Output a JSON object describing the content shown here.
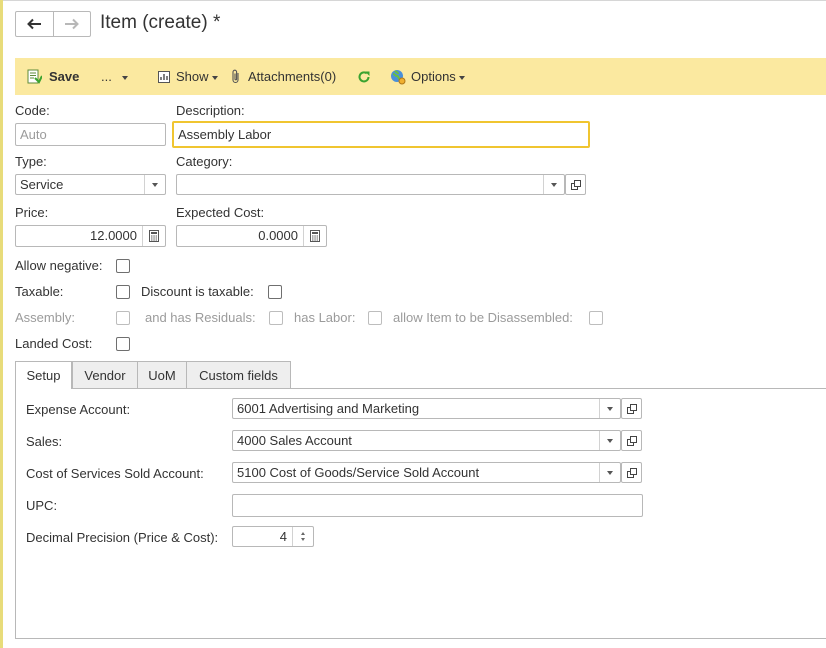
{
  "header": {
    "title": "Item (create) *"
  },
  "icons": {
    "back": "arrow-left-icon",
    "forward": "arrow-right-icon",
    "save": "save-document-icon",
    "show": "report-icon",
    "attachments": "paperclip-icon",
    "refresh": "refresh-icon",
    "options": "globe-gear-icon",
    "calendar": "calculator-icon",
    "open": "open-window-icon"
  },
  "toolbar": {
    "save_label": "Save",
    "more_label": "...",
    "show_label": "Show",
    "attachments_label": "Attachments(0)",
    "options_label": "Options"
  },
  "form": {
    "code": {
      "label": "Code:",
      "placeholder": "Auto",
      "value": ""
    },
    "description": {
      "label": "Description:",
      "value": "Assembly Labor"
    },
    "type": {
      "label": "Type:",
      "value": "Service"
    },
    "category": {
      "label": "Category:",
      "value": ""
    },
    "price": {
      "label": "Price:",
      "value": "12.0000"
    },
    "expected_cost": {
      "label": "Expected Cost:",
      "value": "0.0000"
    },
    "allow_negative": {
      "label": "Allow negative:",
      "checked": false
    },
    "taxable": {
      "label": "Taxable:",
      "checked": false
    },
    "discount_taxable": {
      "label": "Discount is taxable:",
      "checked": false
    },
    "assembly": {
      "label": "Assembly:",
      "checked": false,
      "enabled": false
    },
    "has_residuals": {
      "label": "and has Residuals:",
      "checked": false,
      "enabled": false
    },
    "has_labor": {
      "label": "has Labor:",
      "checked": false,
      "enabled": false
    },
    "allow_disassemble": {
      "label": "allow Item to be Disassembled:",
      "checked": false,
      "enabled": false
    },
    "landed_cost": {
      "label": "Landed Cost:",
      "checked": false
    }
  },
  "tabs": [
    {
      "label": "Setup",
      "active": true
    },
    {
      "label": "Vendor",
      "active": false
    },
    {
      "label": "UoM",
      "active": false
    },
    {
      "label": "Custom fields",
      "active": false
    }
  ],
  "setup": {
    "expense_account": {
      "label": "Expense Account:",
      "value": "6001 Advertising and Marketing"
    },
    "sales": {
      "label": "Sales:",
      "value": "4000 Sales Account"
    },
    "cost_of_services": {
      "label": "Cost of Services Sold Account:",
      "value": "5100 Cost of Goods/Service Sold Account"
    },
    "upc": {
      "label": "UPC:",
      "value": ""
    },
    "decimal_precision": {
      "label": "Decimal Precision (Price & Cost):",
      "value": "4"
    }
  },
  "colors": {
    "toolbar_bg": "#fbe9a0",
    "focus_border": "#f0c530",
    "refresh_green": "#3aa32f"
  }
}
